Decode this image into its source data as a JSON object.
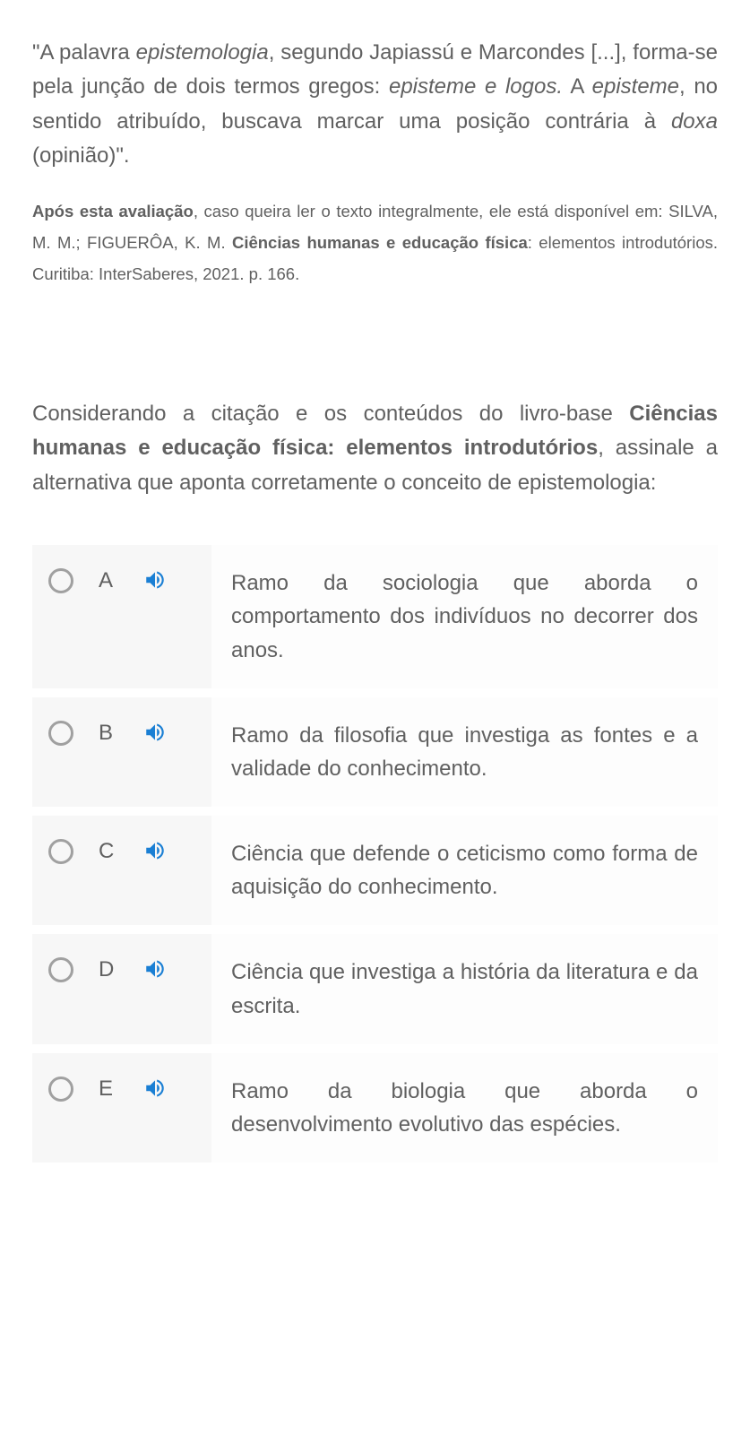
{
  "quote": {
    "pre": "\"A palavra ",
    "i1": "epistemologia",
    "mid1": ", segundo Japiassú e Marcondes [...], forma-se pela junção de dois termos gregos: ",
    "i2": "episteme e logos.",
    "mid2": " A ",
    "i3": "episteme",
    "mid3": ", no sentido atribuído, buscava marcar uma posição contrária à ",
    "i4": "doxa",
    "post": " (opinião)\"."
  },
  "reference": {
    "b1": "Após esta avaliação",
    "t1": ", caso queira ler o texto integralmente, ele está disponível em: SILVA, M. M.; FIGUERÔA, K. M. ",
    "b2": "Ciências humanas e educação física",
    "t2": ": elementos introdutórios. Curitiba: InterSaberes, 2021. p. 166."
  },
  "question": {
    "t1": "Considerando a citação e os conteúdos do livro-base ",
    "b1": "Ciências humanas e educação física: elementos introdutórios",
    "t2": ", assinale a alternativa que aponta corretamente o conceito de epistemologia:"
  },
  "options": [
    {
      "letter": "A",
      "text": "Ramo da sociologia que aborda o comportamento dos indivíduos no decorrer dos anos."
    },
    {
      "letter": "B",
      "text": "Ramo da filosofia que investiga as fontes e a validade do conhecimento."
    },
    {
      "letter": "C",
      "text": "Ciência que defende o ceticismo como forma de aquisição do conhecimento."
    },
    {
      "letter": "D",
      "text": "Ciência que investiga a história da literatura e da escrita."
    },
    {
      "letter": "E",
      "text": "Ramo da biologia que aborda o desenvolvimento evolutivo das espécies."
    }
  ]
}
